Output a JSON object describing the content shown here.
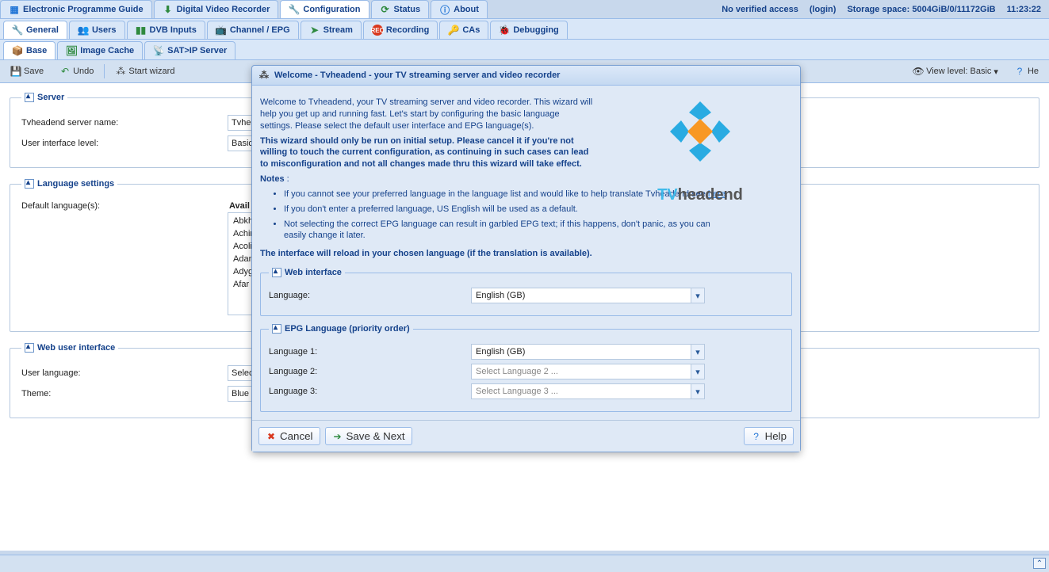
{
  "topTabs": {
    "epg": "Electronic Programme Guide",
    "dvr": "Digital Video Recorder",
    "cfg": "Configuration",
    "status": "Status",
    "about": "About"
  },
  "header": {
    "access": "No verified access",
    "login": "(login)",
    "storageLabel": "Storage space:",
    "storageValue": "5004GiB/0/11172GiB",
    "clock": "11:23:22"
  },
  "tabs2": {
    "general": "General",
    "users": "Users",
    "dvb": "DVB Inputs",
    "channel": "Channel / EPG",
    "stream": "Stream",
    "recording": "Recording",
    "cas": "CAs",
    "debug": "Debugging"
  },
  "tabs3": {
    "base": "Base",
    "imgcache": "Image Cache",
    "satip": "SAT>IP Server"
  },
  "toolbar": {
    "save": "Save",
    "undo": "Undo",
    "wizard": "Start wizard",
    "viewLevel": "View level: Basic",
    "help": "He"
  },
  "server": {
    "legend": "Server",
    "nameLabel": "Tvheadend server name:",
    "nameValue": "Tvhe",
    "uiLabel": "User interface level:",
    "uiValue": "Basic"
  },
  "lang": {
    "legend": "Language settings",
    "defLabel": "Default language(s):",
    "availLabel": "Avail",
    "items": [
      "Abkh",
      "Achin",
      "Acoli",
      "Adan",
      "Adyg",
      "Afar"
    ]
  },
  "webui": {
    "legend": "Web user interface",
    "userLang": "User language:",
    "userLangVal": "Selec",
    "theme": "Theme:",
    "themeVal": "Blue"
  },
  "modal": {
    "title": "Welcome - Tvheadend - your TV streaming server and video recorder",
    "p1": "Welcome to Tvheadend, your TV streaming server and video recorder.",
    "p2": "This wizard will help you get up and running fast. Let's start by configuring the basic language settings. Please select the default user interface and EPG language(s).",
    "p3": "This wizard should only be run on initial setup. Please cancel it if you're not willing to touch the current configuration, as continuing in such cases can lead to misconfiguration and not all changes made thru this wizard will take effect.",
    "notes": "Notes",
    "n1a": "If you cannot see your preferred language in the language list and would like to help translate Tvheadend see ",
    "n1link": "here",
    "n2": "If you don't enter a preferred language, US English will be used as a default.",
    "n3": "Not selecting the correct EPG language can result in garbled EPG text; if this happens, don't panic, as you can easily change it later.",
    "p4": "The interface will reload in your chosen language (if the translation is available).",
    "fsWeb": "Web interface",
    "langLabel": "Language:",
    "langValue": "English (GB)",
    "fsEpg": "EPG Language (priority order)",
    "l1": "Language 1:",
    "l1v": "English (GB)",
    "l2": "Language 2:",
    "l2v": "Select Language 2 ...",
    "l3": "Language 3:",
    "l3v": "Select Language 3 ...",
    "cancel": "Cancel",
    "next": "Save & Next",
    "help": "Help",
    "logo": {
      "a": "TV",
      "b": "headend"
    }
  }
}
